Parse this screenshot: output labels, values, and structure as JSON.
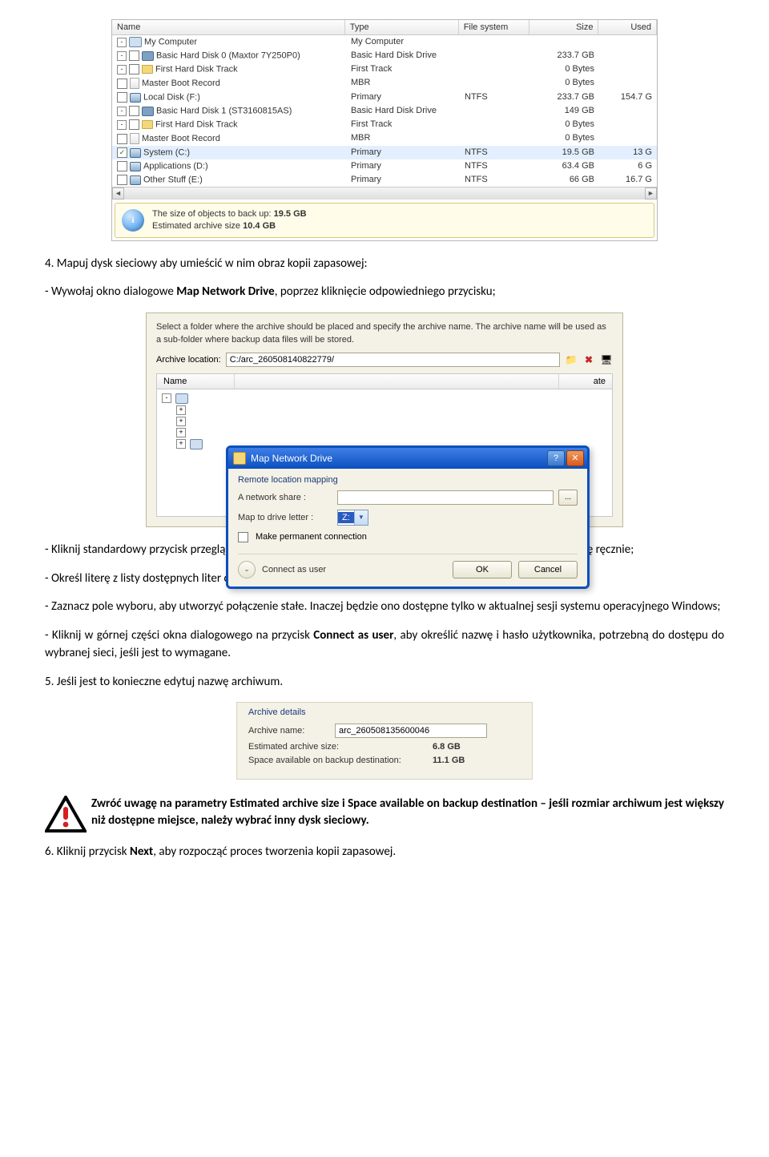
{
  "disk_table": {
    "headers": {
      "name": "Name",
      "type": "Type",
      "fs": "File system",
      "size": "Size",
      "used": "Used"
    },
    "rows": [
      {
        "indent": 0,
        "tree": "-",
        "chk": null,
        "icon": "mycomp",
        "name": "My Computer",
        "type": "My Computer",
        "fs": "",
        "size": "",
        "used": ""
      },
      {
        "indent": 1,
        "tree": "-",
        "chk": "",
        "icon": "disk",
        "name": "Basic Hard Disk 0 (Maxtor 7Y250P0)",
        "type": "Basic Hard Disk Drive",
        "fs": "",
        "size": "233.7 GB",
        "used": ""
      },
      {
        "indent": 2,
        "tree": "-",
        "chk": "",
        "icon": "folder",
        "name": "First Hard Disk Track",
        "type": "First Track",
        "fs": "",
        "size": "0 Bytes",
        "used": ""
      },
      {
        "indent": 3,
        "tree": null,
        "chk": "",
        "icon": "mbr",
        "name": "Master Boot Record",
        "type": "MBR",
        "fs": "",
        "size": "0 Bytes",
        "used": ""
      },
      {
        "indent": 2,
        "tree": null,
        "chk": "",
        "icon": "vol",
        "name": "Local Disk (F:)",
        "type": "Primary",
        "fs": "NTFS",
        "size": "233.7 GB",
        "used": "154.7 G"
      },
      {
        "indent": 1,
        "tree": "-",
        "chk": "",
        "icon": "disk",
        "name": "Basic Hard Disk 1 (ST3160815AS)",
        "type": "Basic Hard Disk Drive",
        "fs": "",
        "size": "149 GB",
        "used": ""
      },
      {
        "indent": 2,
        "tree": "-",
        "chk": "",
        "icon": "folder",
        "name": "First Hard Disk Track",
        "type": "First Track",
        "fs": "",
        "size": "0 Bytes",
        "used": ""
      },
      {
        "indent": 3,
        "tree": null,
        "chk": "",
        "icon": "mbr",
        "name": "Master Boot Record",
        "type": "MBR",
        "fs": "",
        "size": "0 Bytes",
        "used": ""
      },
      {
        "indent": 2,
        "tree": null,
        "chk": "x",
        "icon": "vol",
        "name": "System (C:)",
        "type": "Primary",
        "fs": "NTFS",
        "size": "19.5 GB",
        "used": "13 G",
        "sel": true
      },
      {
        "indent": 2,
        "tree": null,
        "chk": "",
        "icon": "vol",
        "name": "Applications (D:)",
        "type": "Primary",
        "fs": "NTFS",
        "size": "63.4 GB",
        "used": "6 G"
      },
      {
        "indent": 2,
        "tree": null,
        "chk": "",
        "icon": "vol",
        "name": "Other Stuff (E:)",
        "type": "Primary",
        "fs": "NTFS",
        "size": "66 GB",
        "used": "16.7 G"
      }
    ],
    "info": {
      "line1_a": "The size of objects to back up: ",
      "line1_b": "19.5 GB",
      "line2_a": "Estimated archive size ",
      "line2_b": "10.4 GB"
    }
  },
  "para1_a": "4. Mapuj dysk sieciowy aby umieścić w nim obraz kopii zapasowej:",
  "para1_b_pre": "- Wywołaj okno dialogowe ",
  "para1_b_bold": "Map Network Drive",
  "para1_b_post": ", poprzez kliknięcie odpowiedniego przycisku;",
  "mnd": {
    "desc": "Select a folder where the archive should be placed and specify the archive name. The archive name will be used as a sub-folder where backup data files will be stored.",
    "arch_label": "Archive location:",
    "arch_value": "C:/arc_260508140822779/",
    "col_name": "Name",
    "col_date": "ate",
    "title": "Map Network Drive",
    "group": "Remote location mapping",
    "share_label": "A network share    :",
    "drive_label": "Map to drive letter :",
    "drive_value": "Z:",
    "perm_label": "Make permanent connection",
    "connect_label": "Connect as user",
    "ok": "OK",
    "cancel": "Cancel",
    "browse": "..."
  },
  "para2": "- Kliknij standardowy przycisk przeglądania […], aby wybrać wymagany udział sieciowy lub podaj do niego ścieżkę ręcznie;",
  "para3": "- Określ literę z listy dostępnych liter dysków;",
  "para4": "- Zaznacz pole wyboru, aby utworzyć połączenie stałe. Inaczej będzie ono dostępne tylko w aktualnej sesji systemu operacyjnego Windows;",
  "para5_pre": "- Kliknij w górnej części okna dialogowego na przycisk ",
  "para5_bold": "Connect as user",
  "para5_post": ", aby określić nazwę i hasło użytkownika, potrzebną do dostępu do wybranej sieci, jeśli jest to wymagane.",
  "para6": "5. Jeśli jest to konieczne edytuj nazwę archiwum.",
  "arch": {
    "title": "Archive details",
    "name_label": "Archive name:",
    "name_value": "arc_260508135600046",
    "est_label": "Estimated archive size:",
    "est_value": "6.8 GB",
    "space_label": "Space available on backup destination:",
    "space_value": "11.1 GB"
  },
  "warn": "Zwróć uwagę na parametry Estimated archive size i Space available on backup destination – jeśli rozmiar archiwum jest większy niż dostępne miejsce, należy wybrać inny dysk sieciowy.",
  "para7_pre": "6. Kliknij przycisk ",
  "para7_bold": "Next",
  "para7_post": ", aby rozpocząć proces tworzenia kopii zapasowej."
}
